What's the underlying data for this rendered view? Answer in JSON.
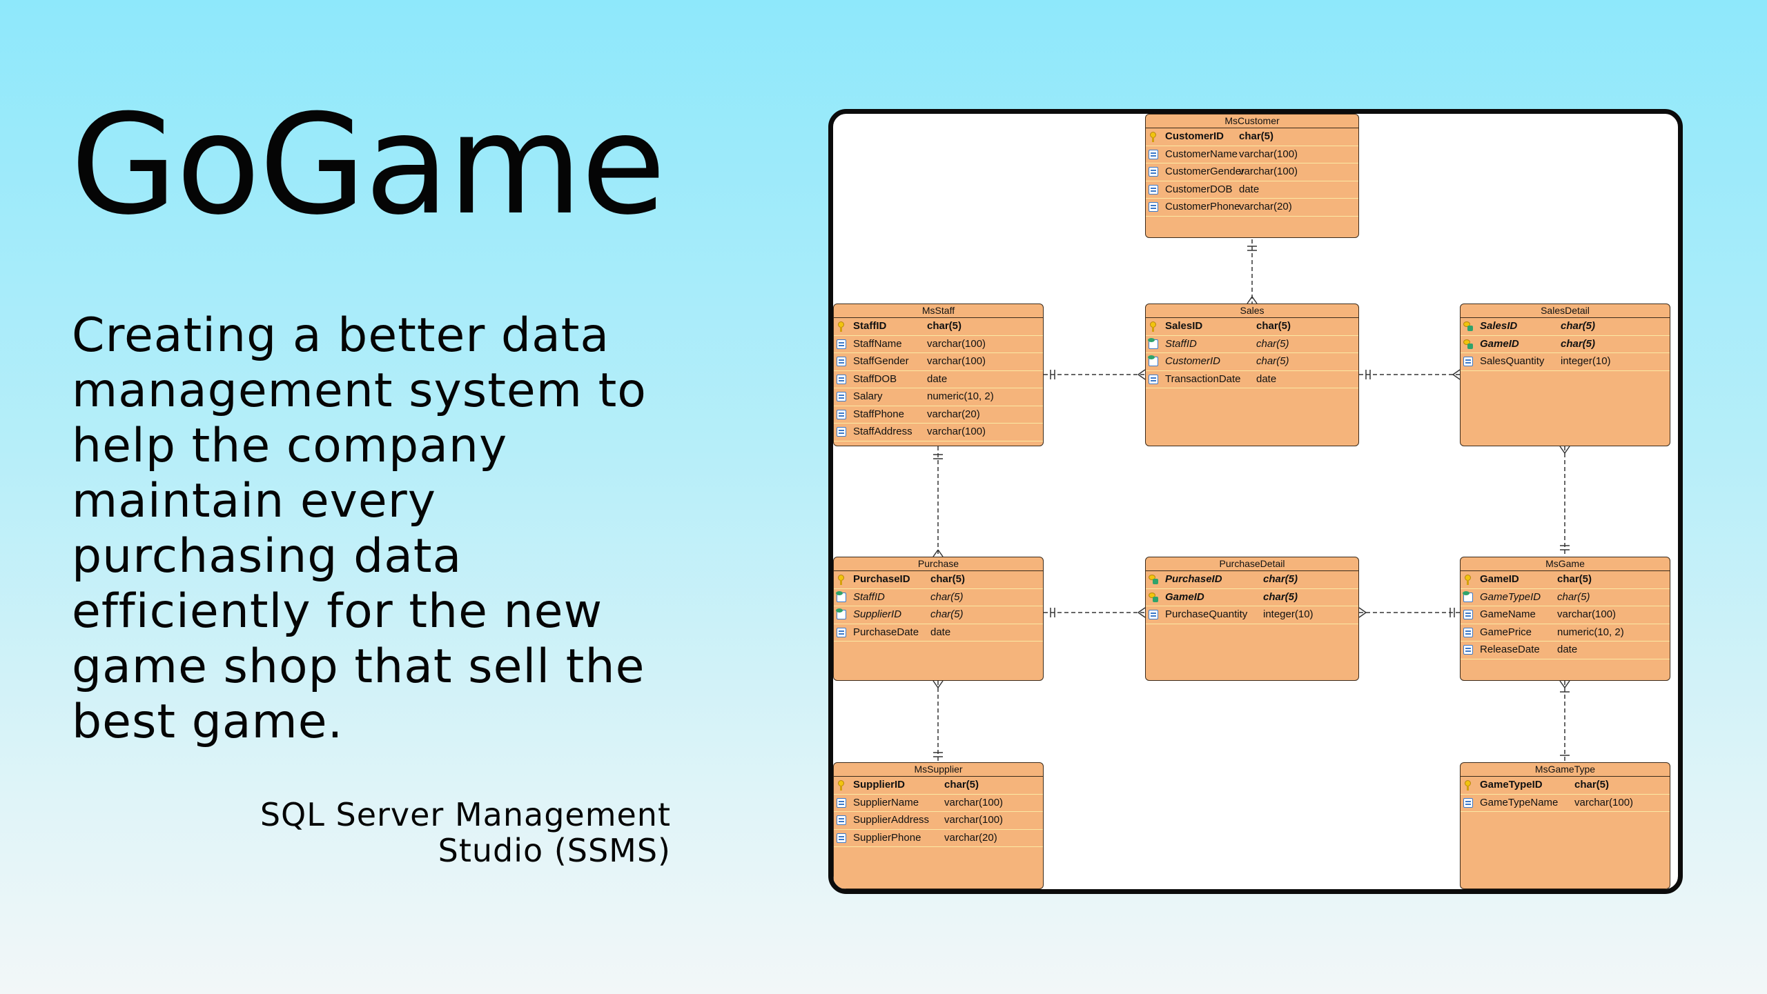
{
  "title": "GoGame",
  "description": "Creating a better data management system to help the company maintain every purchasing data efficiently for the new game shop that sell the best game.",
  "tool": "SQL Server Management Studio (SSMS)",
  "colors": {
    "entity_fill": "#f5b47b",
    "row_separator": "#fbe9a4",
    "background_top": "#8ee8fb",
    "background_bottom": "#f2f7f8"
  },
  "diagram": {
    "entities": [
      {
        "id": "mscustomer",
        "name": "MsCustomer",
        "columns": [
          {
            "name": "CustomerID",
            "type": "char(5)",
            "kind": "pk",
            "icon": "primary-key-icon"
          },
          {
            "name": "CustomerName",
            "type": "varchar(100)",
            "kind": "col",
            "icon": "column-icon"
          },
          {
            "name": "CustomerGender",
            "type": "varchar(100)",
            "kind": "col",
            "icon": "column-icon"
          },
          {
            "name": "CustomerDOB",
            "type": "date",
            "kind": "col",
            "icon": "column-icon"
          },
          {
            "name": "CustomerPhone",
            "type": "varchar(20)",
            "kind": "col",
            "icon": "column-icon"
          }
        ]
      },
      {
        "id": "msstaff",
        "name": "MsStaff",
        "columns": [
          {
            "name": "StaffID",
            "type": "char(5)",
            "kind": "pk",
            "icon": "primary-key-icon"
          },
          {
            "name": "StaffName",
            "type": "varchar(100)",
            "kind": "col",
            "icon": "column-icon"
          },
          {
            "name": "StaffGender",
            "type": "varchar(100)",
            "kind": "col",
            "icon": "column-icon"
          },
          {
            "name": "StaffDOB",
            "type": "date",
            "kind": "col",
            "icon": "column-icon"
          },
          {
            "name": "Salary",
            "type": "numeric(10, 2)",
            "kind": "col",
            "icon": "column-icon"
          },
          {
            "name": "StaffPhone",
            "type": "varchar(20)",
            "kind": "col",
            "icon": "column-icon"
          },
          {
            "name": "StaffAddress",
            "type": "varchar(100)",
            "kind": "col",
            "icon": "column-icon"
          }
        ]
      },
      {
        "id": "sales",
        "name": "Sales",
        "columns": [
          {
            "name": "SalesID",
            "type": "char(5)",
            "kind": "pk",
            "icon": "primary-key-icon"
          },
          {
            "name": "StaffID",
            "type": "char(5)",
            "kind": "fk",
            "icon": "foreign-key-icon"
          },
          {
            "name": "CustomerID",
            "type": "char(5)",
            "kind": "fk",
            "icon": "foreign-key-icon"
          },
          {
            "name": "TransactionDate",
            "type": "date",
            "kind": "col",
            "icon": "column-icon"
          }
        ]
      },
      {
        "id": "salesdetail",
        "name": "SalesDetail",
        "columns": [
          {
            "name": "SalesID",
            "type": "char(5)",
            "kind": "pkfk",
            "icon": "primary-foreign-key-icon"
          },
          {
            "name": "GameID",
            "type": "char(5)",
            "kind": "pkfk",
            "icon": "primary-foreign-key-icon"
          },
          {
            "name": "SalesQuantity",
            "type": "integer(10)",
            "kind": "col",
            "icon": "column-icon"
          }
        ]
      },
      {
        "id": "purchase",
        "name": "Purchase",
        "columns": [
          {
            "name": "PurchaseID",
            "type": "char(5)",
            "kind": "pk",
            "icon": "primary-key-icon"
          },
          {
            "name": "StaffID",
            "type": "char(5)",
            "kind": "fk",
            "icon": "foreign-key-icon"
          },
          {
            "name": "SupplierID",
            "type": "char(5)",
            "kind": "fk",
            "icon": "foreign-key-icon"
          },
          {
            "name": "PurchaseDate",
            "type": "date",
            "kind": "col",
            "icon": "column-icon"
          }
        ]
      },
      {
        "id": "purchasedetail",
        "name": "PurchaseDetail",
        "columns": [
          {
            "name": "PurchaseID",
            "type": "char(5)",
            "kind": "pkfk",
            "icon": "primary-foreign-key-icon"
          },
          {
            "name": "GameID",
            "type": "char(5)",
            "kind": "pkfk",
            "icon": "primary-foreign-key-icon"
          },
          {
            "name": "PurchaseQuantity",
            "type": "integer(10)",
            "kind": "col",
            "icon": "column-icon"
          }
        ]
      },
      {
        "id": "msgame",
        "name": "MsGame",
        "columns": [
          {
            "name": "GameID",
            "type": "char(5)",
            "kind": "pk",
            "icon": "primary-key-icon"
          },
          {
            "name": "GameTypeID",
            "type": "char(5)",
            "kind": "fk",
            "icon": "foreign-key-icon"
          },
          {
            "name": "GameName",
            "type": "varchar(100)",
            "kind": "col",
            "icon": "column-icon"
          },
          {
            "name": "GamePrice",
            "type": "numeric(10, 2)",
            "kind": "col",
            "icon": "column-icon"
          },
          {
            "name": "ReleaseDate",
            "type": "date",
            "kind": "col",
            "icon": "column-icon"
          }
        ]
      },
      {
        "id": "mssupplier",
        "name": "MsSupplier",
        "columns": [
          {
            "name": "SupplierID",
            "type": "char(5)",
            "kind": "pk",
            "icon": "primary-key-icon"
          },
          {
            "name": "SupplierName",
            "type": "varchar(100)",
            "kind": "col",
            "icon": "column-icon"
          },
          {
            "name": "SupplierAddress",
            "type": "varchar(100)",
            "kind": "col",
            "icon": "column-icon"
          },
          {
            "name": "SupplierPhone",
            "type": "varchar(20)",
            "kind": "col",
            "icon": "column-icon"
          }
        ]
      },
      {
        "id": "msgametype",
        "name": "MsGameType",
        "columns": [
          {
            "name": "GameTypeID",
            "type": "char(5)",
            "kind": "pk",
            "icon": "primary-key-icon"
          },
          {
            "name": "GameTypeName",
            "type": "varchar(100)",
            "kind": "col",
            "icon": "column-icon"
          }
        ]
      }
    ],
    "relationships": [
      {
        "from": "mscustomer",
        "to": "sales"
      },
      {
        "from": "msstaff",
        "to": "sales"
      },
      {
        "from": "sales",
        "to": "salesdetail"
      },
      {
        "from": "msgame",
        "to": "salesdetail"
      },
      {
        "from": "msstaff",
        "to": "purchase"
      },
      {
        "from": "purchase",
        "to": "purchasedetail"
      },
      {
        "from": "msgame",
        "to": "purchasedetail"
      },
      {
        "from": "mssupplier",
        "to": "purchase"
      },
      {
        "from": "msgametype",
        "to": "msgame"
      }
    ]
  }
}
